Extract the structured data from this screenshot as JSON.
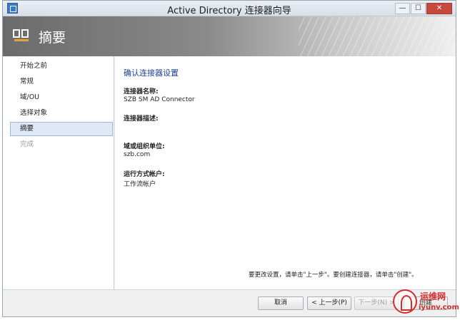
{
  "window": {
    "title": "Active Directory 连接器向导",
    "controls": {
      "minimize": "—",
      "maximize": "☐",
      "close": "✕"
    }
  },
  "banner": {
    "icon": "wizard-blocks-icon",
    "title": "摘要"
  },
  "nav": {
    "items": [
      {
        "label": "开始之前",
        "state": "normal"
      },
      {
        "label": "常规",
        "state": "normal"
      },
      {
        "label": "域/OU",
        "state": "normal"
      },
      {
        "label": "选择对象",
        "state": "normal"
      },
      {
        "label": "摘要",
        "state": "selected"
      },
      {
        "label": "完成",
        "state": "disabled"
      }
    ]
  },
  "content": {
    "heading": "确认连接器设置",
    "fields": [
      {
        "label": "连接器名称:",
        "value": "SZB SM AD Connector"
      },
      {
        "label": "连接器描述:",
        "value": ""
      },
      {
        "label": "域或组织单位:",
        "value": "szb.com"
      },
      {
        "label": "运行方式帐户:",
        "value": "工作流帐户"
      }
    ],
    "hint": "要更改设置，请单击\"上一步\"。要创建连接器，请单击\"创建\"。"
  },
  "buttons": {
    "cancel": "取消",
    "prev": "< 上一步(P)",
    "next": "下一步(N) >",
    "create": "创建"
  },
  "watermark": {
    "line1": "运维网",
    "line2": "iyunv.com"
  },
  "colors": {
    "heading": "#1c3f94",
    "selected_bg": "#dfe9f6",
    "close_button": "#c7483c",
    "watermark": "#d62b2b"
  }
}
